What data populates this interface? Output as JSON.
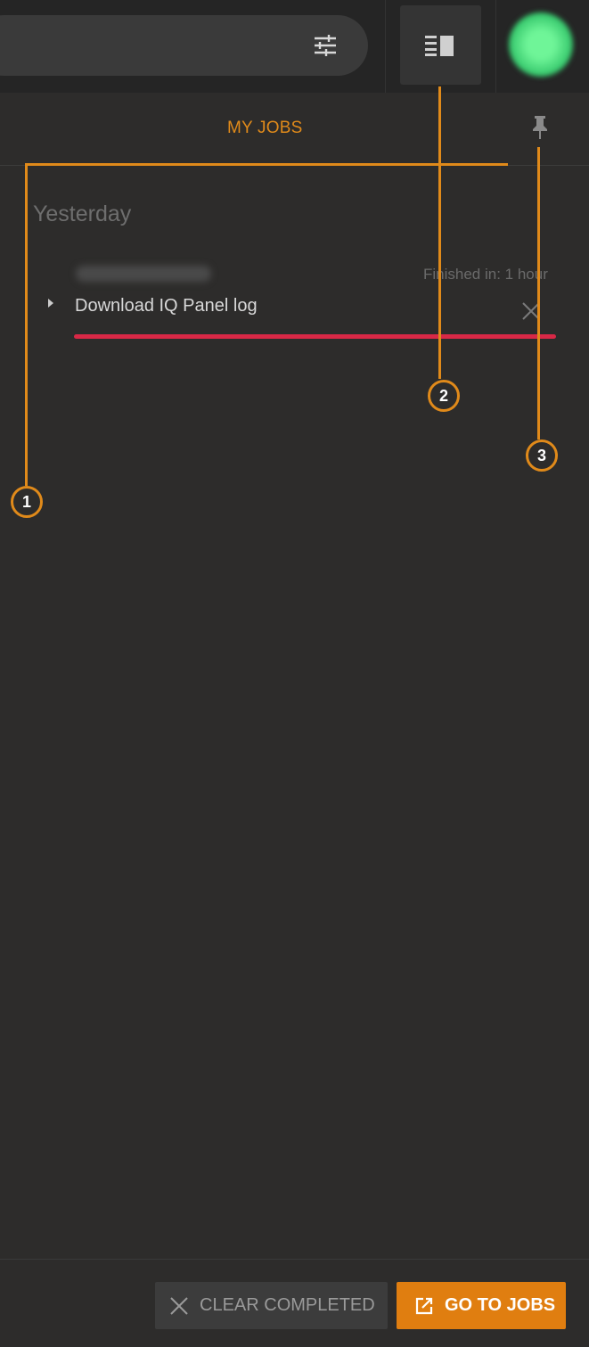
{
  "header": {
    "filter_icon": "tune-icon",
    "panel_icon": "panel-toggle-icon",
    "avatar_color": "#5fe58c"
  },
  "tabs": {
    "active_label": "MY JOBS",
    "pin_icon": "pin-icon",
    "accent": "#e08a1a"
  },
  "jobs": {
    "group_title": "Yesterday",
    "items": [
      {
        "title": "Download IQ Panel log",
        "finished": "Finished in: 1 hour",
        "status_color": "#d82846",
        "progress": 1.0
      }
    ]
  },
  "callouts": [
    "1",
    "2",
    "3"
  ],
  "footer": {
    "clear_label": "CLEAR COMPLETED",
    "go_label": "GO TO JOBS"
  }
}
